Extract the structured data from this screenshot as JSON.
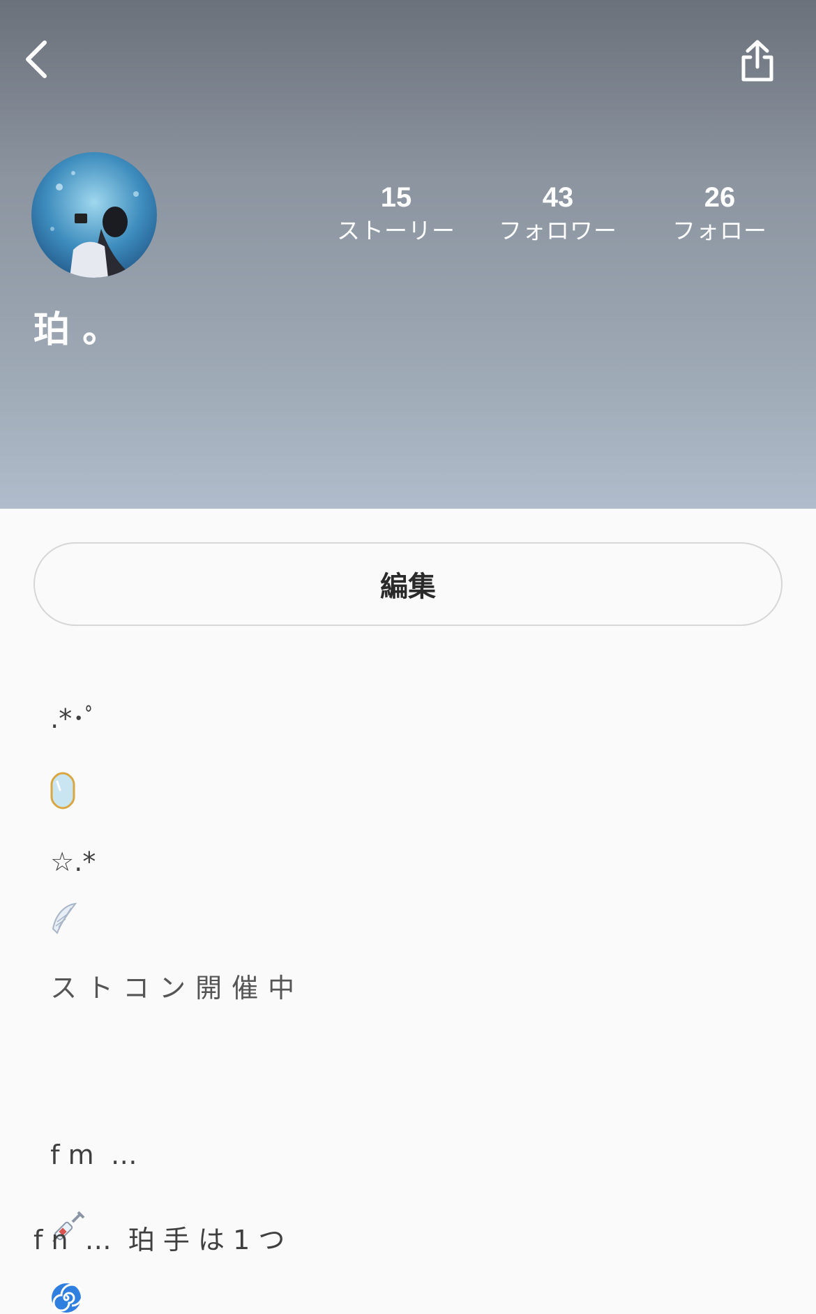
{
  "profile": {
    "username": "珀 。",
    "stats": [
      {
        "value": "15",
        "label": "ストーリー"
      },
      {
        "value": "43",
        "label": "フォロワー"
      },
      {
        "value": "26",
        "label": "フォロー"
      }
    ],
    "edit_label": "編集"
  },
  "icons": {
    "back": "chevron-left-icon",
    "share": "share-icon",
    "mirror": "mirror-icon",
    "wing": "wing-icon",
    "syringe": "syringe-icon",
    "cyclone": "cyclone-icon"
  },
  "bio": {
    "line1_a": ".*･ﾟ",
    "line1_b": "☆.*",
    "line2": "ストコン開催中",
    "line3_a": "f m  …",
    "line4": "f n  …  珀 手 は 1 つ"
  },
  "colors": {
    "header_top": "#6b717b",
    "header_bottom": "#b0bccb",
    "background": "#fafafa",
    "text": "#3f3f3f"
  }
}
